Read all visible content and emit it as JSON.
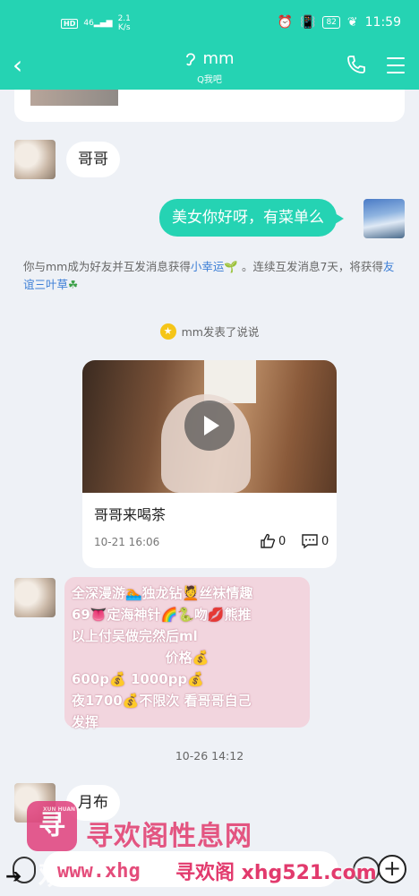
{
  "status_bar": {
    "hd": "HD",
    "signal": "46",
    "speed_value": "2.1",
    "speed_unit": "K/s",
    "battery": "82",
    "time": "11:59"
  },
  "header": {
    "title": "mm",
    "subtitle": "Q我吧"
  },
  "messages": {
    "m1_text": "哥哥",
    "m2_text": "美女你好呀，有菜单么",
    "system_part1": "你与mm成为好友并互发消息获得",
    "system_link1": "小幸运",
    "system_part2": "。连续互发消息7天，将获得",
    "system_link2": "友谊三叶草",
    "post_notice": "mm发表了说说",
    "post": {
      "title": "哥哥来喝茶",
      "time": "10-21 16:06",
      "likes": "0",
      "comments": "0"
    },
    "image_lines": [
      "全深漫游🏊独龙钻💆丝袜情趣",
      "69👅定海神针🌈🐍吻💋熊推",
      "以上付吴做完然后ml",
      "价格💰",
      "600p💰 1000pp💰",
      "夜1700💰不限次 看哥哥自己",
      "发挥"
    ],
    "timestamp": "10-26 14:12",
    "m3_text": "月布"
  },
  "watermark": {
    "logo_text": "寻欢",
    "logo_small": "XUN HUAN",
    "cn": "寻欢阁性息网",
    "url": "www.xhg",
    "url2": "寻欢阁 xhg521.com"
  },
  "input": {
    "plus": "+"
  }
}
